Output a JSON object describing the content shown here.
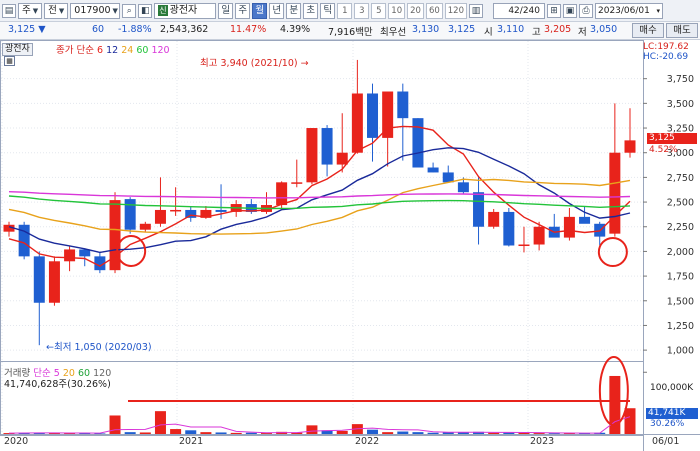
{
  "toolbar": {
    "market": "주",
    "search_icon": "search-icon",
    "code": "017900",
    "name_badge": "신",
    "name": "광전자",
    "periods": [
      "일",
      "주",
      "월",
      "년",
      "분",
      "초",
      "틱"
    ],
    "selected_period": "월",
    "intervals": [
      "1",
      "3",
      "5",
      "10",
      "20",
      "60",
      "120"
    ],
    "count": "42",
    "count_total": "/240",
    "date": "2023/06/01"
  },
  "quote": {
    "price": "3,125",
    "arrow": "▼",
    "change": "60",
    "change_pct": "-1.88%",
    "volume": "2,543,362",
    "turnover_pct": "11.47%",
    "ratio": "4.39%",
    "amount": "7,916백만",
    "best_label": "최우선",
    "best_ask": "3,130",
    "best_bid": "3,125",
    "open_label": "시",
    "open": "3,110",
    "high_label": "고",
    "high": "3,205",
    "low_label": "저",
    "low": "3,050",
    "buy_button": "매수",
    "sell_button": "매도"
  },
  "overlay": {
    "stock_tag": "광전자",
    "ma_title": "종가 단순",
    "ma_periods": [
      "6",
      "12",
      "24",
      "60",
      "120"
    ],
    "lc": "LC:197.62",
    "hc": "HC:-20.69",
    "max_note": "최고 3,940 (2021/10)",
    "min_note": "최저 1,050 (2020/03)",
    "last_price": "3,125",
    "last_pct": "4.52%",
    "vol_title": "거래량",
    "vol_type": "단순",
    "vol_periods": [
      "5",
      "20",
      "60",
      "120"
    ],
    "vol_value": "41,740,628주(30.26%)",
    "vol_last": "41,741K",
    "vol_last_pct": "30.26%",
    "vol_axis": "100,000K"
  },
  "colors": {
    "up": "#e8231b",
    "down": "#1f5fd1",
    "ma6": "#e8231b",
    "ma12": "#1a2a9a",
    "ma24": "#e8a21b",
    "ma60": "#22c33a",
    "ma120": "#d936d9"
  },
  "chart_data": {
    "type": "candlestick",
    "y_ticks": [
      "3,750",
      "3,500",
      "3,250",
      "3,000",
      "2,750",
      "2,500",
      "2,250",
      "2,000",
      "1,750",
      "1,500",
      "1,250",
      "1,000"
    ],
    "x_labels": [
      "2020",
      "2021",
      "2022",
      "2023",
      "06/01"
    ],
    "candles": [
      [
        2200,
        2300,
        2150,
        2270
      ],
      [
        2270,
        2300,
        1920,
        1950
      ],
      [
        1950,
        2000,
        1050,
        1480
      ],
      [
        1480,
        1950,
        1450,
        1900
      ],
      [
        1900,
        2050,
        1800,
        2020
      ],
      [
        2020,
        2030,
        1850,
        1950
      ],
      [
        1950,
        1990,
        1780,
        1810
      ],
      [
        1810,
        2600,
        1780,
        2520
      ],
      [
        2530,
        2550,
        2180,
        2220
      ],
      [
        2220,
        2300,
        2200,
        2280
      ],
      [
        2280,
        2750,
        2250,
        2420
      ],
      [
        2420,
        2650,
        2360,
        2420
      ],
      [
        2420,
        2450,
        2300,
        2340
      ],
      [
        2340,
        2460,
        2330,
        2420
      ],
      [
        2420,
        2680,
        2330,
        2400
      ],
      [
        2400,
        2520,
        2350,
        2480
      ],
      [
        2480,
        2530,
        2380,
        2400
      ],
      [
        2400,
        2600,
        2380,
        2470
      ],
      [
        2470,
        2710,
        2420,
        2700
      ],
      [
        2700,
        2930,
        2650,
        2700
      ],
      [
        2700,
        3250,
        2680,
        3250
      ],
      [
        3250,
        3280,
        2760,
        2880
      ],
      [
        2880,
        3400,
        2800,
        3000
      ],
      [
        3000,
        3940,
        2990,
        3600
      ],
      [
        3600,
        3700,
        2910,
        3150
      ],
      [
        3150,
        3450,
        2860,
        3620
      ],
      [
        3620,
        3700,
        2920,
        3350
      ],
      [
        3350,
        3350,
        2920,
        2850
      ],
      [
        2850,
        2900,
        2800,
        2800
      ],
      [
        2800,
        2870,
        2720,
        2700
      ],
      [
        2700,
        2750,
        2580,
        2600
      ],
      [
        2600,
        2750,
        2070,
        2250
      ],
      [
        2250,
        2430,
        2230,
        2400
      ],
      [
        2400,
        2440,
        2050,
        2060
      ],
      [
        2060,
        2250,
        1990,
        2070
      ],
      [
        2070,
        2300,
        2010,
        2250
      ],
      [
        2250,
        2380,
        2150,
        2140
      ],
      [
        2140,
        2440,
        2110,
        2350
      ],
      [
        2350,
        2460,
        2290,
        2280
      ],
      [
        2280,
        2300,
        2060,
        2150
      ],
      [
        2180,
        3500,
        2150,
        3000
      ],
      [
        3000,
        3450,
        2950,
        3125
      ]
    ],
    "volume_k": [
      1500,
      1800,
      2200,
      1600,
      1200,
      1000,
      900,
      30000,
      3000,
      2500,
      37000,
      8000,
      6000,
      3000,
      2500,
      1800,
      2000,
      1500,
      3500,
      2200,
      14000,
      6000,
      5000,
      16000,
      7000,
      3000,
      4000,
      3000,
      2000,
      2500,
      2800,
      3500,
      2000,
      2200,
      1800,
      1500,
      1200,
      1000,
      1400,
      2000,
      94000,
      41741
    ],
    "vol_scale_max": 115000
  }
}
